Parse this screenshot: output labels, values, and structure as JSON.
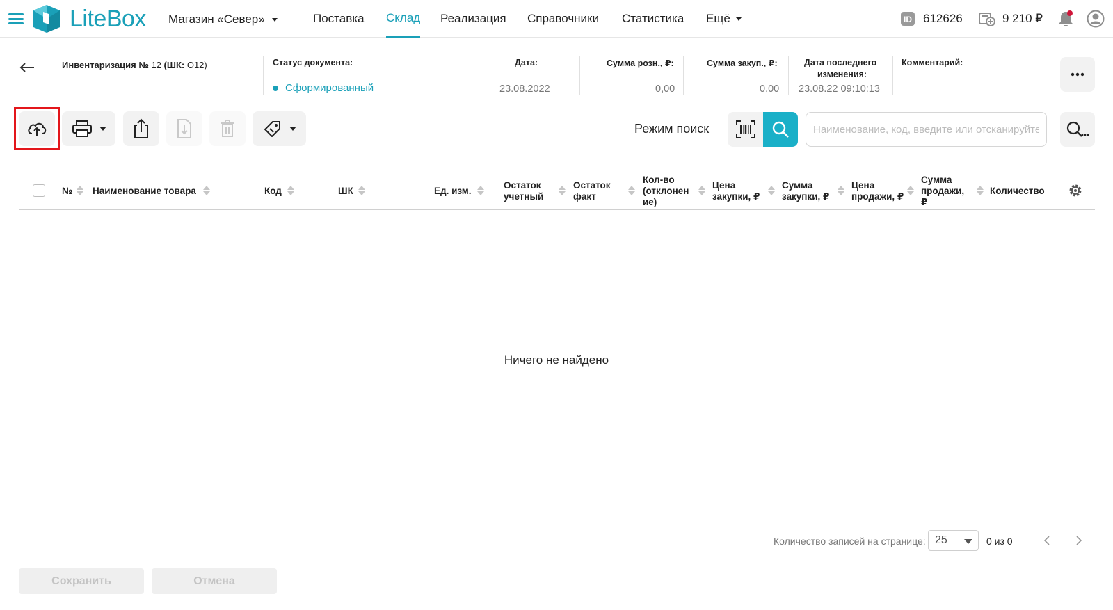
{
  "nav": {
    "logo_text": "LiteBox",
    "store": "Магазин «Север»",
    "items": [
      "Поставка",
      "Склад",
      "Реализация",
      "Справочники",
      "Статистика",
      "Ещё"
    ],
    "active": "Склад",
    "account_id": "612626",
    "balance": "9 210 ₽"
  },
  "doc": {
    "title_prefix": "Инвентаризация №",
    "number": "12",
    "barcode_label": "(ШК:",
    "barcode": "О12)",
    "status_label": "Статус документа:",
    "status_value": "Сформированный",
    "date_label": "Дата:",
    "date_value": "23.08.2022",
    "retail_sum_label": "Сумма розн., ₽:",
    "retail_sum_value": "0,00",
    "purchase_sum_label": "Сумма закуп., ₽:",
    "purchase_sum_value": "0,00",
    "last_change_label_1": "Дата последнего",
    "last_change_label_2": "изменения:",
    "last_change_value": "23.08.22 09:10:13",
    "comment_label": "Комментарий:"
  },
  "toolbar": {
    "search_mode_label": "Режим поиск",
    "search_placeholder": "Наименование, код, введите или отсканируйте"
  },
  "table": {
    "columns": [
      [
        "№"
      ],
      [
        "Наименование товара"
      ],
      [
        "Код"
      ],
      [
        "ШК"
      ],
      [
        "Ед. изм."
      ],
      [
        "Остаток",
        "учетный"
      ],
      [
        "Остаток",
        "факт"
      ],
      [
        "Кол-во",
        "(отклонен",
        "ие)"
      ],
      [
        "Цена",
        "закупки, ₽"
      ],
      [
        "Сумма",
        "закупки, ₽"
      ],
      [
        "Цена",
        "продажи, ₽"
      ],
      [
        "Сумма",
        "продажи,",
        "₽"
      ],
      [
        "Количество"
      ]
    ],
    "empty_text": "Ничего не найдено"
  },
  "pagination": {
    "label": "Количество записей на странице:",
    "page_size": "25",
    "count": "0 из 0"
  },
  "footer": {
    "save": "Сохранить",
    "cancel": "Отмена"
  },
  "colors": {
    "accent": "#1aa0b8",
    "highlight": "#e3161b"
  }
}
